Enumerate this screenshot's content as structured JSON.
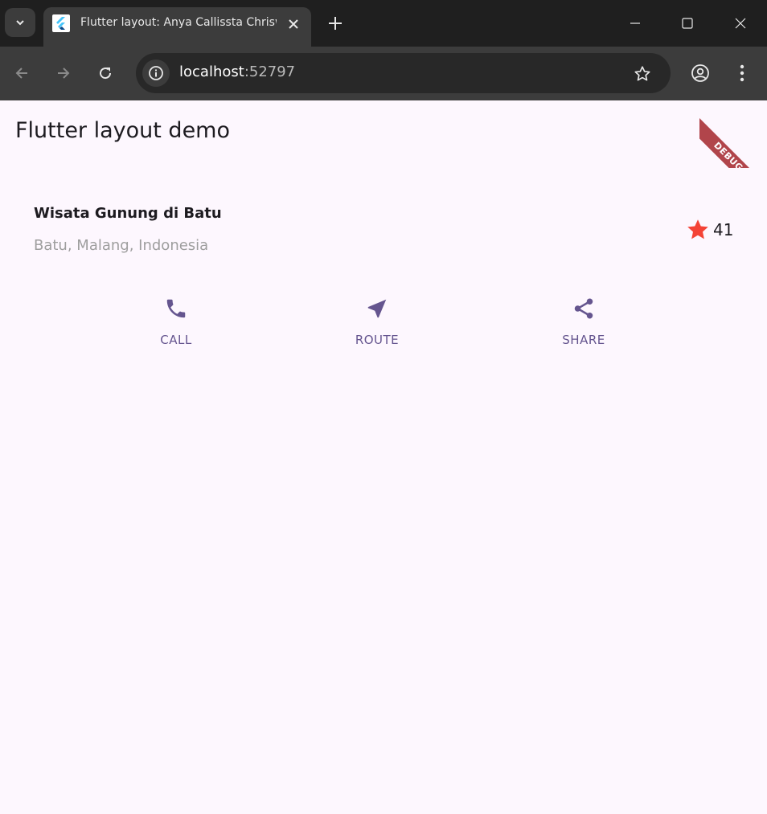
{
  "browser": {
    "tab_title": "Flutter layout: Anya Callissta Chriswantari",
    "url_host": "localhost",
    "url_port": ":52797",
    "icons": {
      "tab_search": "chevron-down-icon",
      "favicon": "flutter-logo-icon",
      "tab_close": "close-icon",
      "new_tab": "plus-icon",
      "minimize": "minimize-icon",
      "maximize": "maximize-icon",
      "close_window": "close-icon",
      "back": "arrow-left-icon",
      "forward": "arrow-right-icon",
      "reload": "reload-icon",
      "site_info": "info-icon",
      "bookmark": "star-outline-icon",
      "profile": "account-circle-icon",
      "menu": "more-vert-icon"
    }
  },
  "app": {
    "title": "Flutter layout demo",
    "debug_label": "DEBUG",
    "place_name": "Wisata Gunung di Batu",
    "place_location": "Batu, Malang, Indonesia",
    "rating_count": "41",
    "actions": [
      {
        "label": "CALL",
        "icon": "phone-icon"
      },
      {
        "label": "ROUTE",
        "icon": "near-me-icon"
      },
      {
        "label": "SHARE",
        "icon": "share-icon"
      }
    ],
    "colors": {
      "background": "#fdf7fe",
      "accent": "#65558f",
      "star": "#f44336",
      "debug_banner": "#a4262c"
    }
  }
}
